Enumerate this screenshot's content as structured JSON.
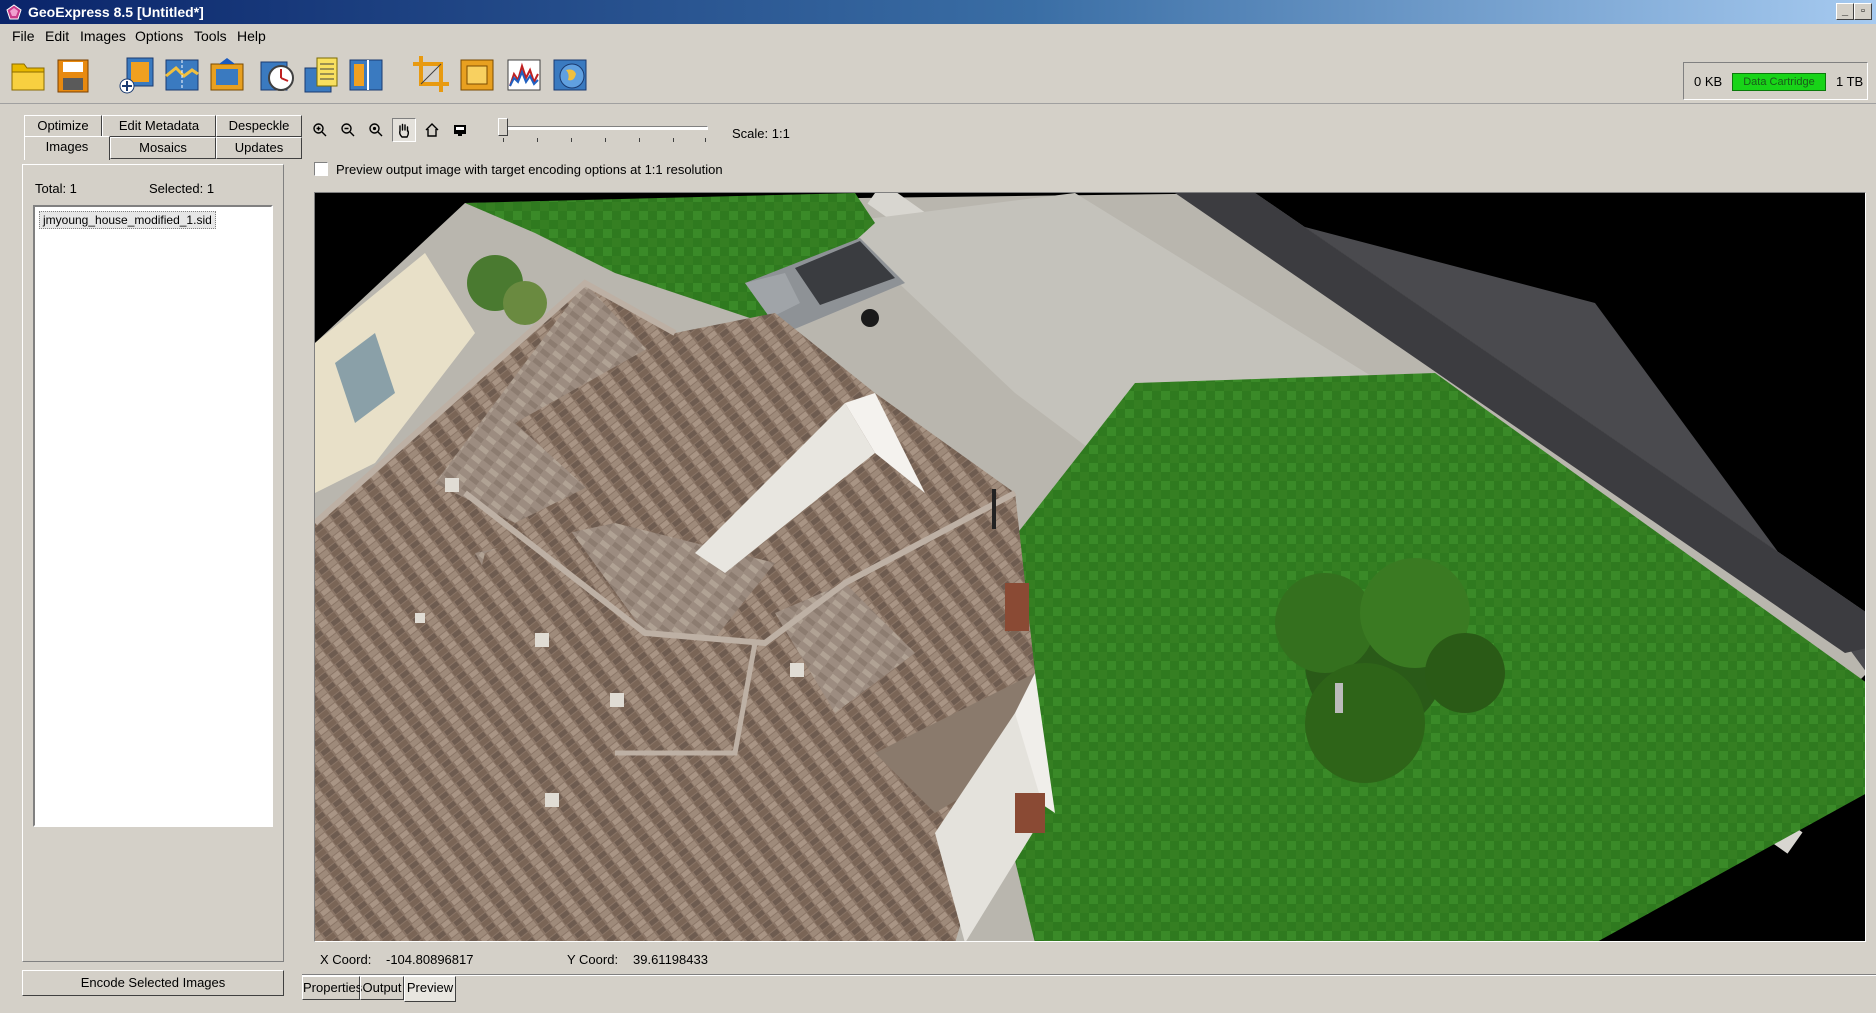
{
  "window": {
    "title": "GeoExpress 8.5 [Untitled*]"
  },
  "menu": [
    "File",
    "Edit",
    "Images",
    "Options",
    "Tools",
    "Help"
  ],
  "toolbar": {
    "buttons": [
      "open-folder-icon",
      "save-icon",
      "add-image-icon",
      "mosaic-icon",
      "export-icon",
      "encode-clock-icon",
      "metadata-icon",
      "split-icon",
      "crop-icon",
      "frame-icon",
      "histogram-icon",
      "globe-icon"
    ]
  },
  "storage": {
    "used": "0 KB",
    "bar_label": "Data Cartridge",
    "capacity": "1 TB",
    "bar_color": "#18d418"
  },
  "left": {
    "tabs_top": [
      "Optimize",
      "Edit Metadata",
      "Despeckle"
    ],
    "tabs_bottom": [
      "Images",
      "Mosaics",
      "Updates"
    ],
    "active_tab": "Images",
    "total": "Total: 1",
    "selected": "Selected: 1",
    "files": [
      "jmyoung_house_modified_1.sid"
    ],
    "encode_label": "Encode Selected Images"
  },
  "view": {
    "tools": [
      "zoom-in-icon",
      "zoom-out-icon",
      "zoom-fit-icon",
      "pan-hand-icon",
      "home-icon",
      "monitor-icon"
    ],
    "active_tool": "pan-hand-icon",
    "scale": "Scale: 1:1",
    "preview_label": "Preview output image with target encoding options at 1:1 resolution",
    "preview_checked": false,
    "x_label": "X Coord:",
    "x_value": "-104.80896817",
    "y_label": "Y Coord:",
    "y_value": "39.61198433"
  },
  "bottom_tabs": [
    "Properties",
    "Output",
    "Preview"
  ],
  "active_bottom_tab": "Preview"
}
